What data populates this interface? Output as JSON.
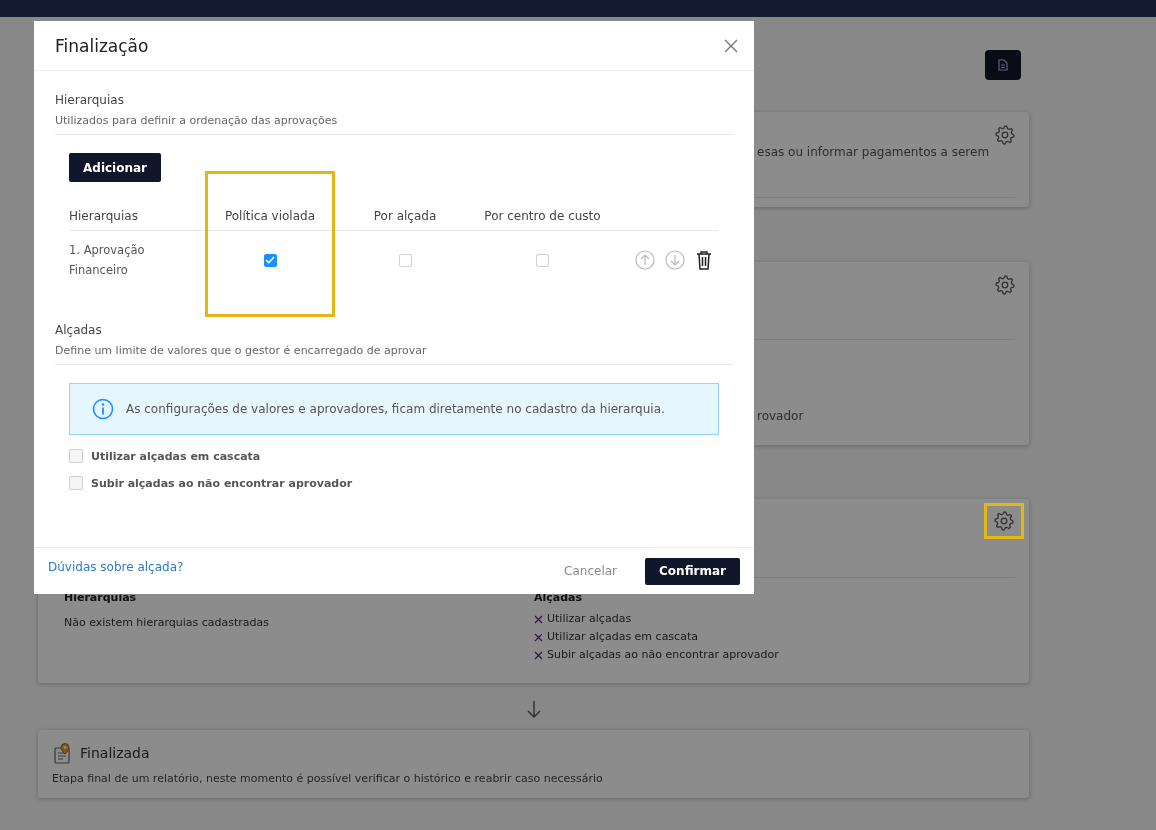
{
  "page": {
    "cards": [
      {
        "kind": "description",
        "text": "esas ou informar pagamentos a serem",
        "settings_highlighted": false
      },
      {
        "kind": "rules",
        "text": "rovador",
        "settings_highlighted": false
      },
      {
        "kind": "summary",
        "hierarchies_heading": "Hierarquias",
        "hierarchies_text": "Não existem hierarquias cadastradas",
        "rules_heading": "Alçadas",
        "rules": [
          {
            "label": "Utilizar alçadas",
            "enabled": false
          },
          {
            "label": "Utilizar alçadas em cascata",
            "enabled": false
          },
          {
            "label": "Subir alçadas ao não encontrar aprovador",
            "enabled": false
          }
        ],
        "settings_highlighted": true
      },
      {
        "kind": "stage",
        "title": "Finalizada",
        "description": "Etapa final de um relatório, neste momento é possível verificar o histórico e reabrir caso necessário"
      }
    ]
  },
  "modal": {
    "title": "Finalização",
    "hierarchies": {
      "title": "Hierarquias",
      "subtitle": "Utilizados para definir a ordenação das aprovações",
      "add_button": "Adicionar",
      "columns": [
        {
          "label": "Hierarquias",
          "highlighted": false
        },
        {
          "label": "Política violada",
          "highlighted": true
        },
        {
          "label": "Por alçada",
          "highlighted": false
        },
        {
          "label": "Por centro de custo",
          "highlighted": false
        }
      ],
      "rows": [
        {
          "name": "1. Aprovação Financeiro",
          "policy_violated": true,
          "by_threshold": false,
          "by_cost_center": false
        }
      ]
    },
    "thresholds": {
      "title": "Alçadas",
      "subtitle": "Define um limite de valores que o gestor é encarregado de aprovar",
      "info": "As configurações de valores e aprovadores, ficam diretamente no cadastro da hierarquia.",
      "options": [
        {
          "label": "Utilizar alçadas em cascata",
          "checked": false
        },
        {
          "label": "Subir alçadas ao não encontrar aprovador",
          "checked": false
        }
      ]
    },
    "footer": {
      "help_link": "Dúvidas sobre alçada?",
      "cancel": "Cancelar",
      "confirm": "Confirmar"
    }
  }
}
